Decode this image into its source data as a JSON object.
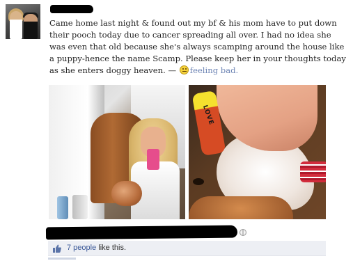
{
  "post": {
    "author_name_redacted": true,
    "text_lines": [
      "Came home last night & found out my bf & his mom have to put down",
      "their pooch today due to cancer spreading all over. I had no idea she",
      "was even that old because she's always scamping around the house like",
      "a puppy-hence the name Scamp. Please keep her in your thoughts today",
      "as she enters doggy heaven. — "
    ],
    "feeling": {
      "icon": "sad-face-icon",
      "text": "feeling bad."
    }
  },
  "photos": [
    {
      "icon": "selfie-photo"
    },
    {
      "icon": "dog-photo",
      "wristband_text": "LOVE"
    }
  ],
  "footer": {
    "privacy_icon": "globe-icon",
    "redacted": true
  },
  "likes": {
    "icon": "thumbs-up-icon",
    "people_text": "7 people",
    "suffix_text": " like this."
  },
  "colors": {
    "link": "#3b5998",
    "feeling_text": "#6d84b4",
    "likes_bar_bg": "#edeff4"
  }
}
